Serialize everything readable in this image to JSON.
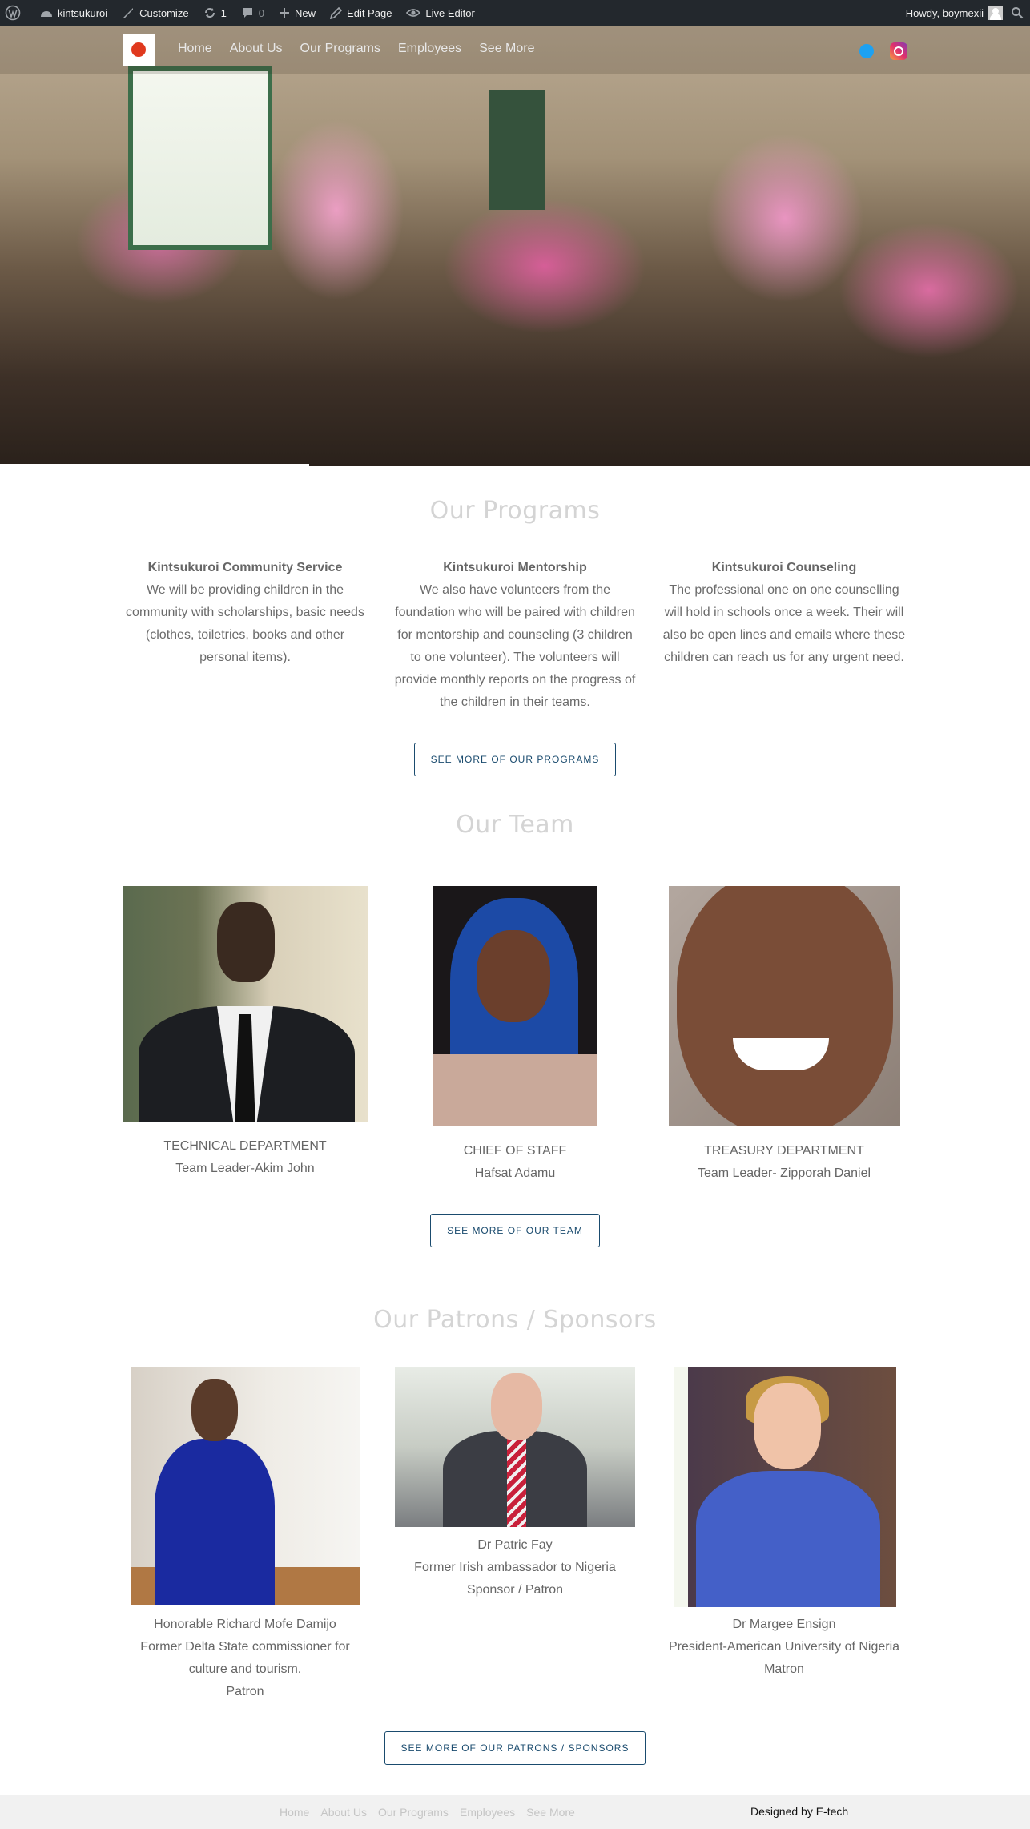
{
  "adminbar": {
    "site_name": "kintsukuroi",
    "customize": "Customize",
    "updates_count": "1",
    "comments_count": "0",
    "new": "New",
    "edit_page": "Edit Page",
    "live_editor": "Live Editor",
    "howdy": "Howdy, boymexii"
  },
  "nav": {
    "items": [
      "Home",
      "About Us",
      "Our Programs",
      "Employees",
      "See More"
    ]
  },
  "programs": {
    "title": "Our Programs",
    "items": [
      {
        "heading": "Kintsukuroi Community Service",
        "text": "We will be providing children in the community with scholarships, basic needs (clothes, toiletries, books and other personal items)."
      },
      {
        "heading": "Kintsukuroi Mentorship",
        "text": "We also have volunteers from the foundation who will be paired with children for mentorship and counseling (3 children to one volunteer). The volunteers will provide monthly reports on the progress of the children in their teams."
      },
      {
        "heading": "Kintsukuroi Counseling",
        "text": "The professional one on one counselling will hold in schools once a week. Their will also be open lines and emails where these children can reach us for any urgent need."
      }
    ],
    "button": "SEE MORE OF OUR PROGRAMS"
  },
  "team": {
    "title": "Our Team",
    "members": [
      {
        "department": "TECHNICAL DEPARTMENT",
        "name": "Team Leader-Akim John"
      },
      {
        "department": "CHIEF OF STAFF",
        "name": "Hafsat Adamu"
      },
      {
        "department": "TREASURY DEPARTMENT",
        "name": "Team Leader- Zipporah Daniel"
      }
    ],
    "button": "SEE MORE OF OUR TEAM"
  },
  "patrons": {
    "title": "Our Patrons / Sponsors",
    "items": [
      {
        "name": "Honorable Richard Mofe Damijo",
        "desc": "Former Delta State commissioner for culture and tourism.",
        "role": "Patron"
      },
      {
        "name": "Dr Patric Fay",
        "desc": "Former Irish ambassador to Nigeria",
        "role": "Sponsor / Patron"
      },
      {
        "name": "Dr Margee Ensign",
        "desc": "President-American University of Nigeria",
        "role": "Matron"
      }
    ],
    "button": "SEE MORE OF OUR PATRONS / SPONSORS"
  },
  "footer": {
    "nav": [
      "Home",
      "About Us",
      "Our Programs",
      "Employees",
      "See More"
    ],
    "credit": "Designed by E-tech"
  },
  "icons": {
    "wordpress": "wordpress-icon",
    "dashboard": "dashboard-icon",
    "brush": "brush-icon",
    "updates": "updates-icon",
    "comment": "comment-icon",
    "plus": "plus-icon",
    "pencil": "pencil-icon",
    "eye": "eye-icon",
    "search": "search-icon",
    "twitter": "twitter-icon",
    "instagram": "instagram-icon"
  },
  "colors": {
    "adminbar_bg": "#23282d",
    "button_border": "#1a4b6e",
    "section_title": "#d4d4d4",
    "footer_bg": "#f1f1f1"
  }
}
